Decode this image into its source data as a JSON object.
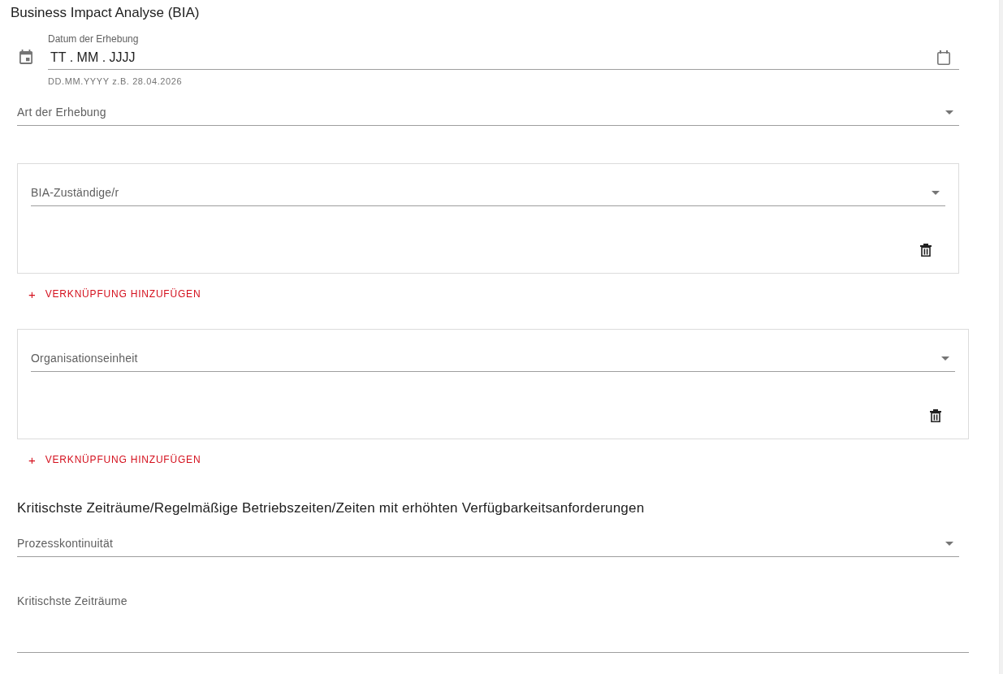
{
  "page_title": "Business Impact Analyse (BIA)",
  "survey_date": {
    "label": "Datum der Erhebung",
    "placeholder": "TT . MM . JJJJ",
    "hint": "DD.MM.YYYY z.B. 28.04.2026"
  },
  "survey_type": {
    "label": "Art der Erhebung"
  },
  "link_groups": [
    {
      "links": [
        {
          "label": "BIA-Zuständige/r"
        }
      ],
      "add_button": {
        "icon": "+",
        "label": "VERKNÜPFUNG HINZUFÜGEN"
      }
    },
    {
      "links": [
        {
          "label": "Organisationseinheit"
        }
      ],
      "add_button": {
        "icon": "+",
        "label": "VERKNÜPFUNG HINZUFÜGEN"
      }
    }
  ],
  "critical_periods": {
    "heading": "Kritischste Zeiträume/Regelmäßige Betriebszeiten/Zeiten mit erhöhten Verfügbarkeitsanforderungen",
    "fields": [
      {
        "kind": "select",
        "label": "Prozesskontinuität"
      },
      {
        "kind": "textarea",
        "label": "Kritischste Zeiträume"
      }
    ]
  }
}
